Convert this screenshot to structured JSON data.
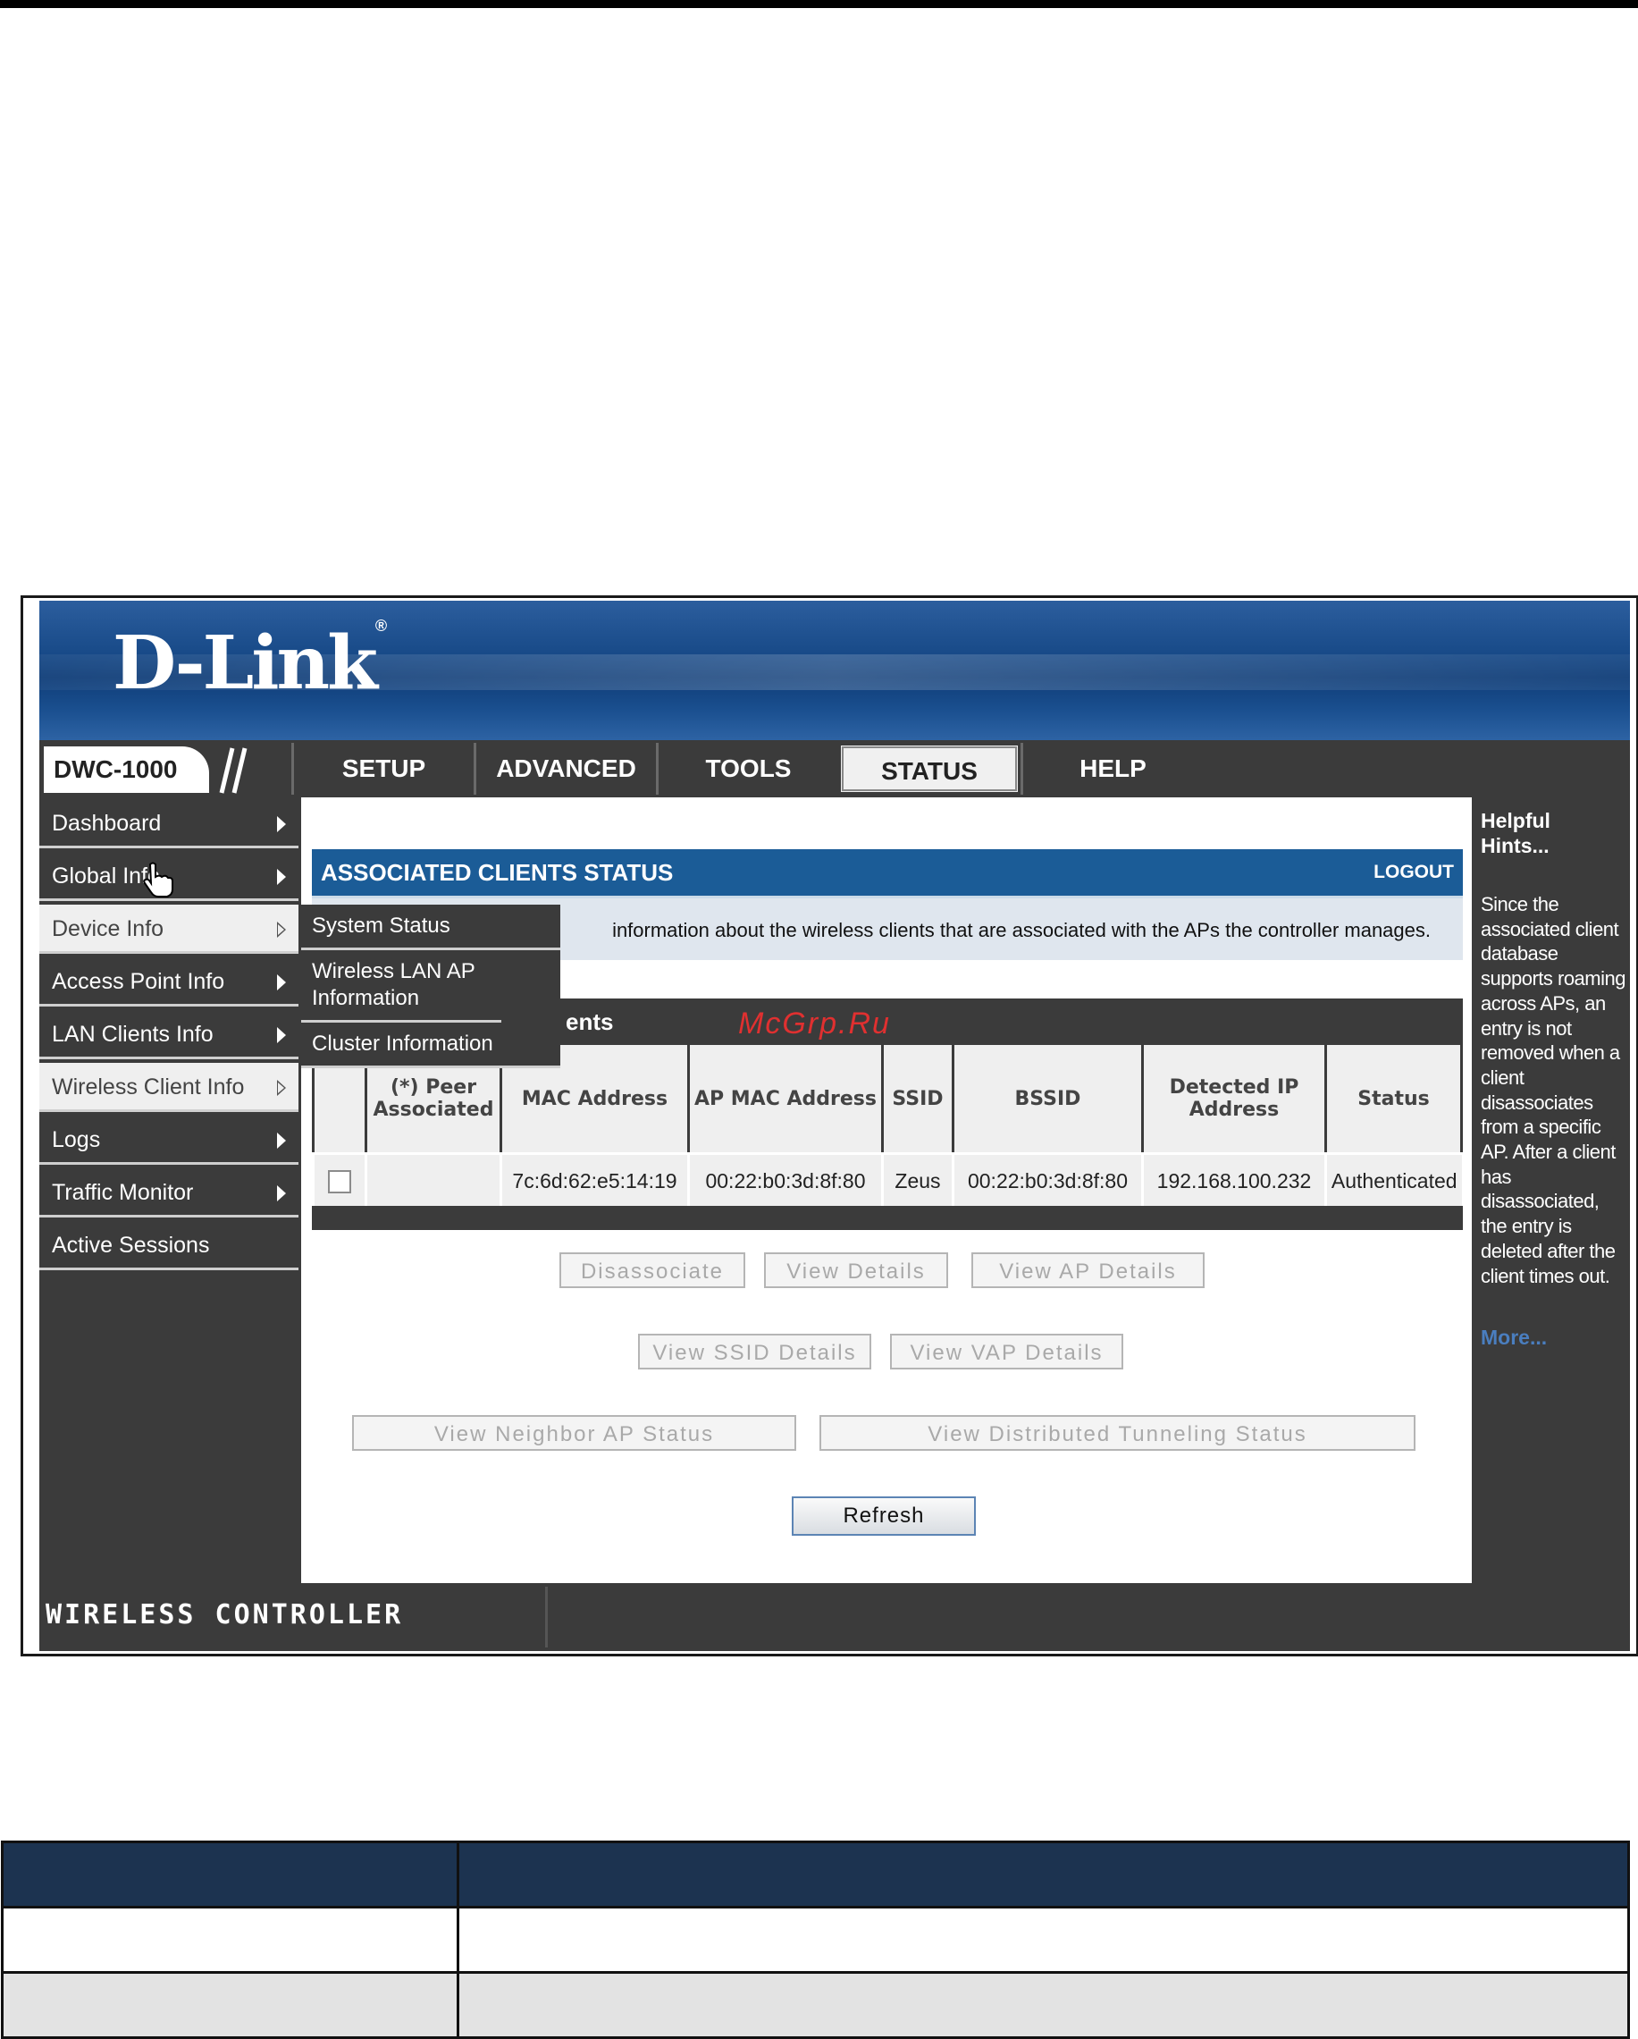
{
  "brand": {
    "logo_text": "D-Link",
    "registered": "®"
  },
  "model": "DWC-1000",
  "nav": {
    "tabs": [
      "SETUP",
      "ADVANCED",
      "TOOLS",
      "STATUS",
      "HELP"
    ],
    "active_tab": "STATUS"
  },
  "sidebar": {
    "items": [
      {
        "label": "Dashboard"
      },
      {
        "label": "Global Info"
      },
      {
        "label": "Device Info"
      },
      {
        "label": "Access Point Info"
      },
      {
        "label": "LAN Clients Info"
      },
      {
        "label": "Wireless Client Info"
      },
      {
        "label": "Logs"
      },
      {
        "label": "Traffic Monitor"
      },
      {
        "label": "Active Sessions"
      }
    ]
  },
  "flyout": {
    "items": [
      "System Status",
      "Wireless LAN AP Information",
      "Cluster Information"
    ]
  },
  "section": {
    "title": "ASSOCIATED CLIENTS STATUS",
    "logout": "LOGOUT",
    "description": "information about the wireless clients that are associated with the APs the controller manages."
  },
  "table": {
    "title_fragment": "ents",
    "headers": [
      "",
      "(*) Peer Associated",
      "MAC Address",
      "AP MAC Address",
      "SSID",
      "BSSID",
      "Detected IP Address",
      "Status"
    ],
    "rows": [
      [
        "",
        "",
        "7c:6d:62:e5:14:19",
        "00:22:b0:3d:8f:80",
        "Zeus",
        "00:22:b0:3d:8f:80",
        "192.168.100.232",
        "Authenticated"
      ]
    ]
  },
  "buttons": {
    "disassociate": "Disassociate",
    "view_details": "View Details",
    "view_ap_details": "View AP Details",
    "view_ssid_details": "View SSID Details",
    "view_vap_details": "View VAP Details",
    "view_neighbor_ap_status": "View Neighbor AP Status",
    "view_distributed_tunneling_status": "View Distributed Tunneling Status",
    "refresh": "Refresh"
  },
  "hints": {
    "title": "Helpful Hints...",
    "body": "Since the associated client database supports roaming across APs, an entry is not removed when a client disassociates from a specific AP. After a client has disassociated, the entry is deleted after the client times out.",
    "more": "More..."
  },
  "footer": {
    "text": "WIRELESS CONTROLLER"
  },
  "watermark": "McGrp.Ru",
  "colors": {
    "nav_dark": "#3b3b3b",
    "section_blue": "#1b5c97",
    "doc_header": "#1c3350",
    "watermark": "#e03030"
  }
}
